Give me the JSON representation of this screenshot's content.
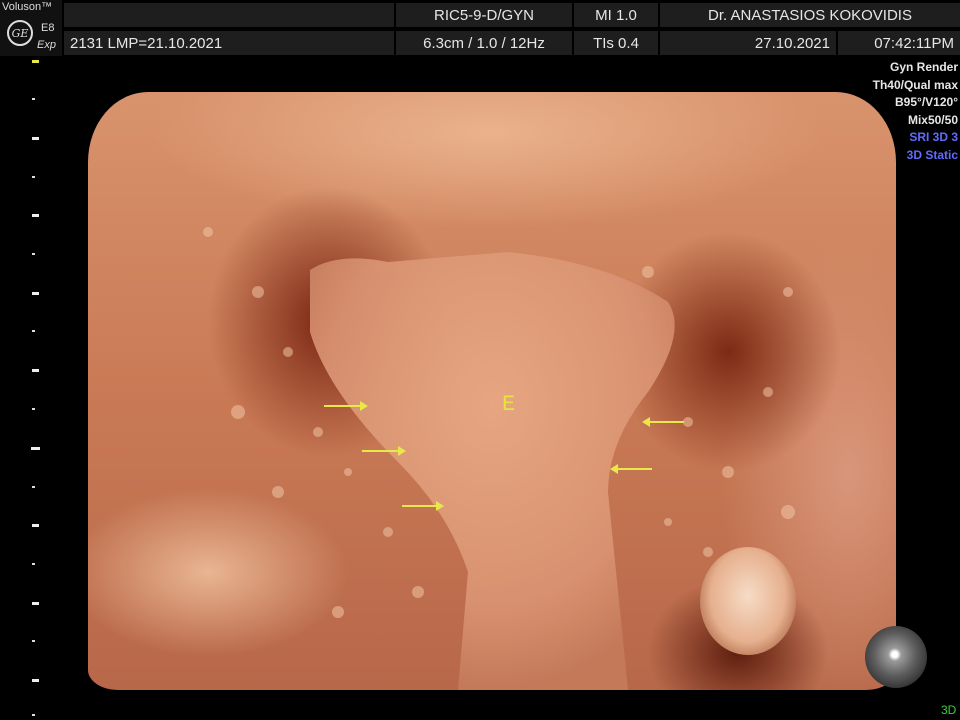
{
  "brand": {
    "name": "Voluson™",
    "logo": "GE",
    "model": "E8",
    "model_sub": "Exp"
  },
  "header": {
    "probe": "RIC5-9-D/GYN",
    "mi": "MI  1.0",
    "doctor": "Dr. ANASTASIOS KOKOVIDIS",
    "patient": "2131  LMP=21.10.2021",
    "depth": "6.3cm / 1.0 / 12Hz",
    "tis": "TIs  0.4",
    "date": "27.10.2021",
    "time": "07:42:11PM"
  },
  "params": {
    "line1": "Gyn Render",
    "line2": "Th40/Qual max",
    "line3": "B95°/V120°",
    "line4": "Mix50/50",
    "line5": "SRI 3D 3",
    "line6": "3D Static"
  },
  "annotation": {
    "label": "E",
    "arrow_color": "#e8e84a"
  },
  "mode": "3D",
  "colors": {
    "accent_blue": "#5f6cff",
    "annotation_yellow": "#e4e43c",
    "mode_green": "#3ecf3e"
  }
}
